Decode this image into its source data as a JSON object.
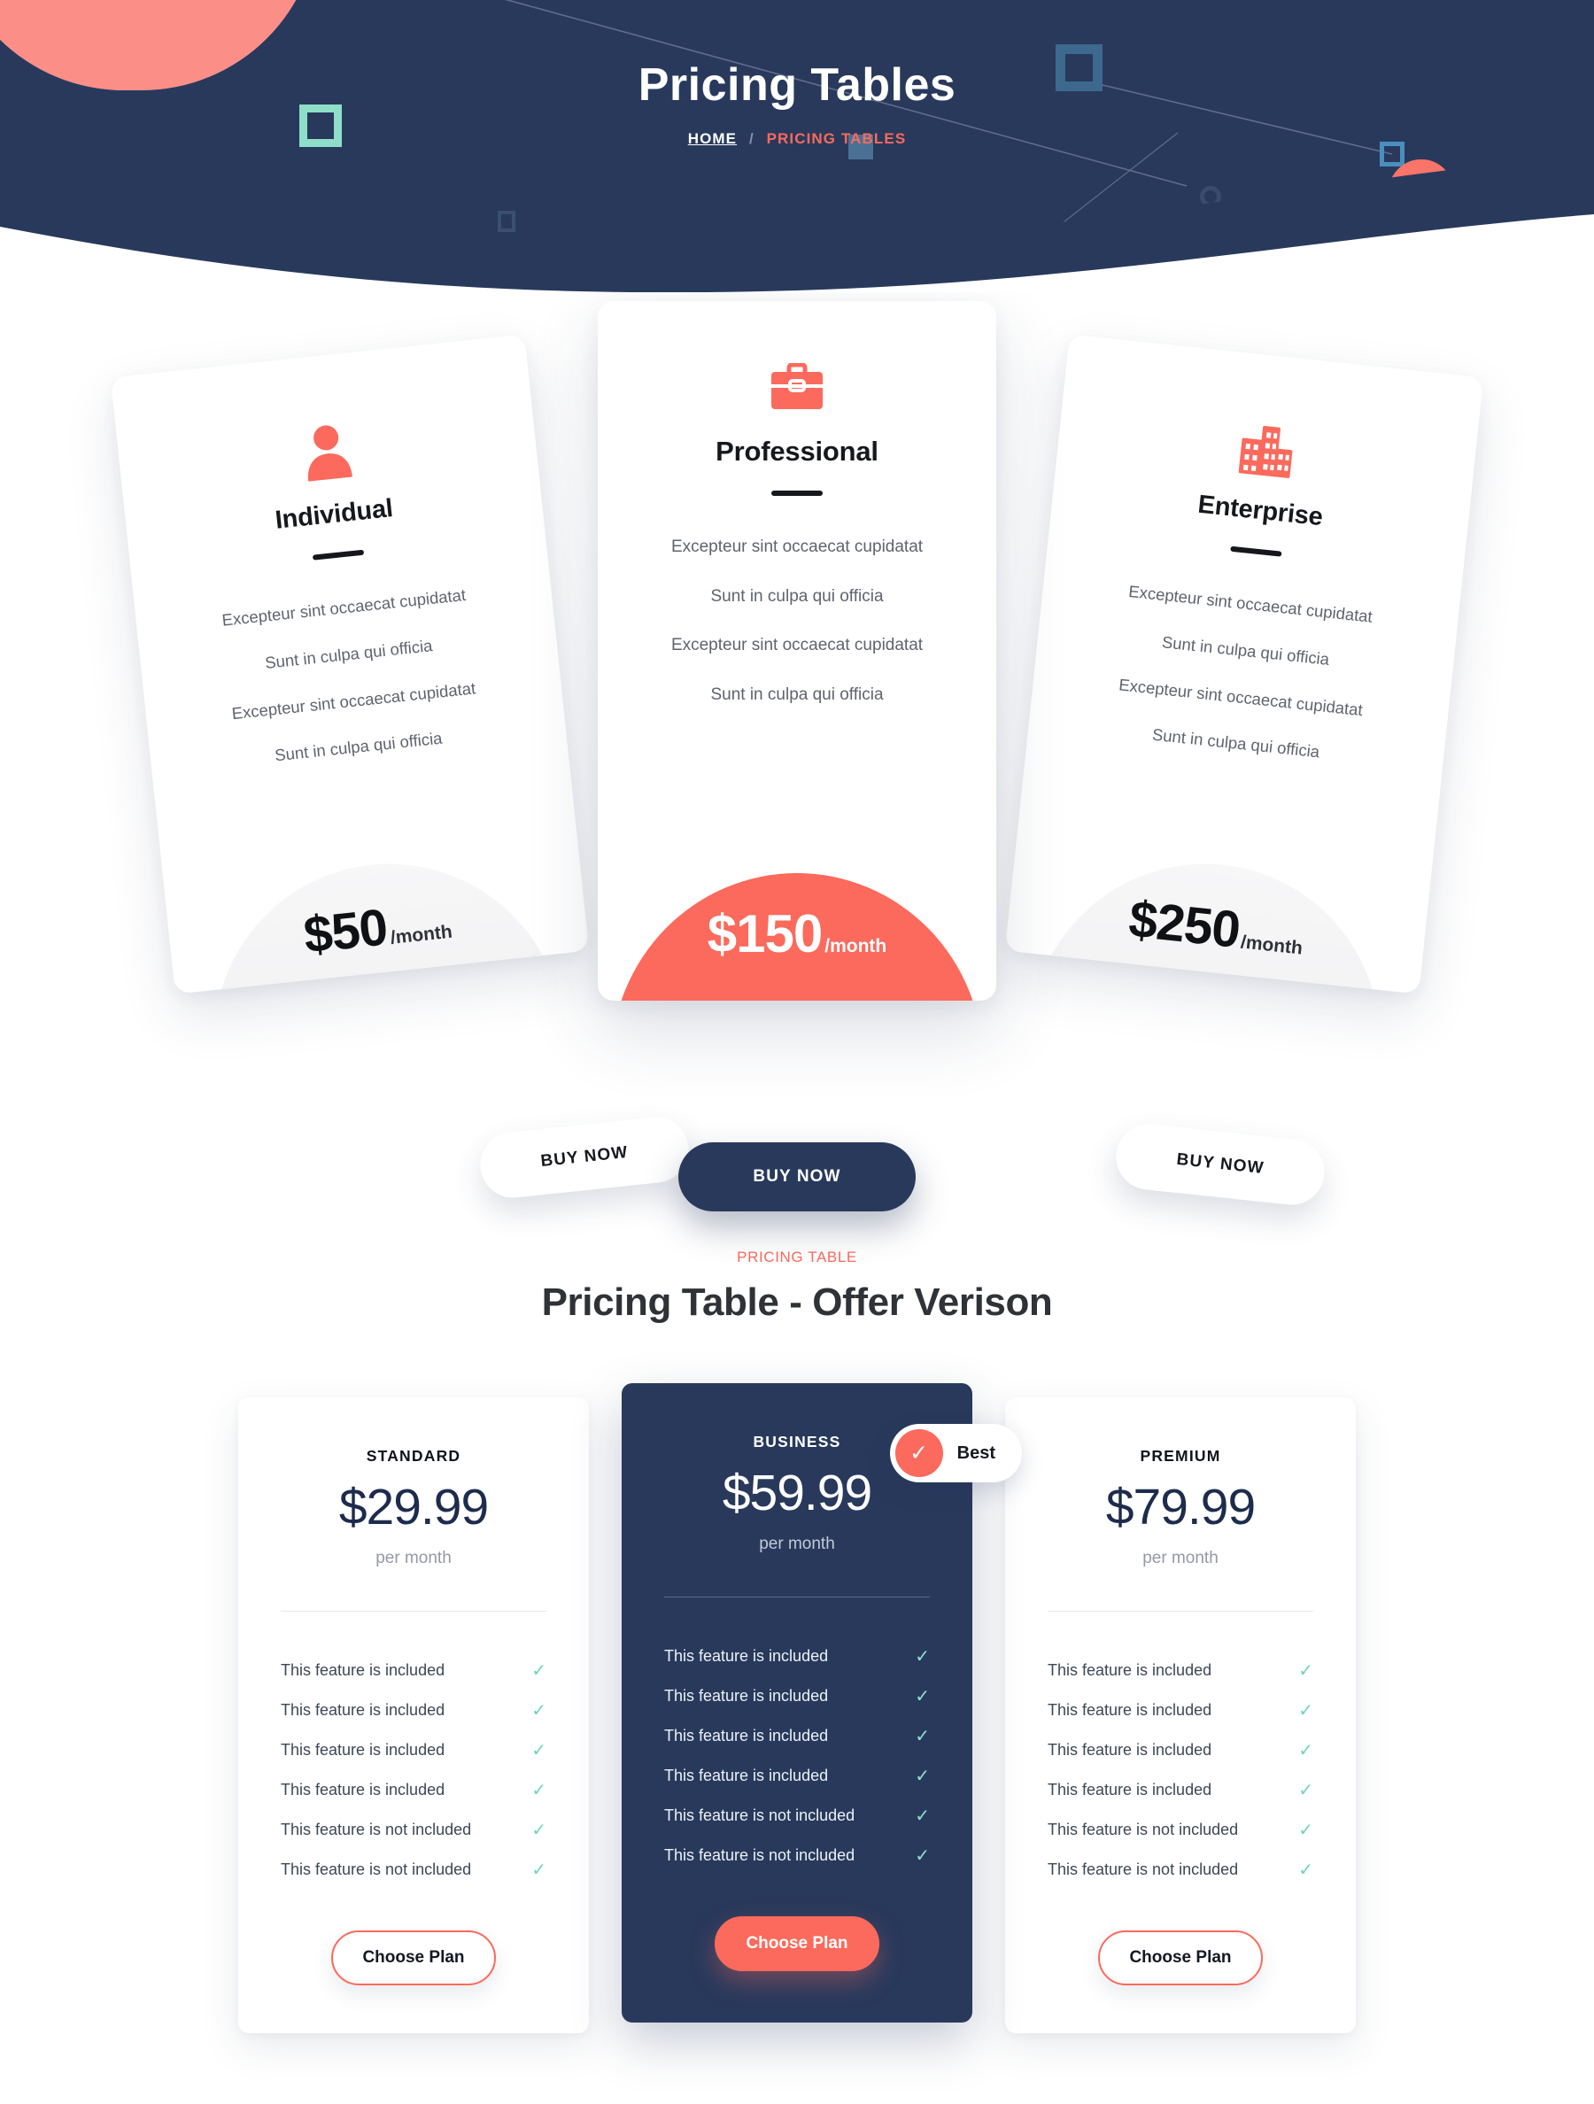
{
  "hero": {
    "title": "Pricing Tables",
    "breadcrumb": {
      "home": "HOME",
      "separator": "/",
      "current": "PRICING TABLES"
    },
    "background_color": "#28395c",
    "accent_color": "#fb6a5c",
    "teal_color": "#8fdec9"
  },
  "tilted_plans": [
    {
      "icon": "user-icon",
      "name": "Individual",
      "features": [
        "Excepteur sint occaecat cupidatat",
        "Sunt in culpa qui officia",
        "Excepteur sint occaecat cupidatat",
        "Sunt in culpa qui officia"
      ],
      "price": "$50",
      "period": "/month",
      "button_label": "BUY NOW"
    },
    {
      "icon": "briefcase-icon",
      "name": "Professional",
      "features": [
        "Excepteur sint occaecat cupidatat",
        "Sunt in culpa qui officia",
        "Excepteur sint occaecat cupidatat",
        "Sunt in culpa qui officia"
      ],
      "price": "$150",
      "period": "/month",
      "button_label": "BUY NOW"
    },
    {
      "icon": "buildings-icon",
      "name": "Enterprise",
      "features": [
        "Excepteur sint occaecat cupidatat",
        "Sunt in culpa qui officia",
        "Excepteur sint occaecat cupidatat",
        "Sunt in culpa qui officia"
      ],
      "price": "$250",
      "period": "/month",
      "button_label": "BUY NOW"
    }
  ],
  "offer_section": {
    "eyebrow": "PRICING TABLE",
    "title": "Pricing Table - Offer Verison",
    "plans": [
      {
        "name": "STANDARD",
        "price": "$29.99",
        "period": "per month",
        "features": [
          "This feature is included",
          "This feature is included",
          "This feature is included",
          "This feature is included",
          "This feature is not included",
          "This feature is not included"
        ],
        "check_glyph": "✓",
        "button_label": "Choose Plan"
      },
      {
        "name": "BUSINESS",
        "price": "$59.99",
        "period": "per month",
        "badge_label": "Best",
        "badge_glyph": "✓",
        "features": [
          "This feature is included",
          "This feature is included",
          "This feature is included",
          "This feature is included",
          "This feature is not included",
          "This feature is not included"
        ],
        "check_glyph": "✓",
        "button_label": "Choose Plan"
      },
      {
        "name": "PREMIUM",
        "price": "$79.99",
        "period": "per month",
        "features": [
          "This feature is included",
          "This feature is included",
          "This feature is included",
          "This feature is included",
          "This feature is not included",
          "This feature is not included"
        ],
        "check_glyph": "✓",
        "button_label": "Choose Plan"
      }
    ]
  }
}
